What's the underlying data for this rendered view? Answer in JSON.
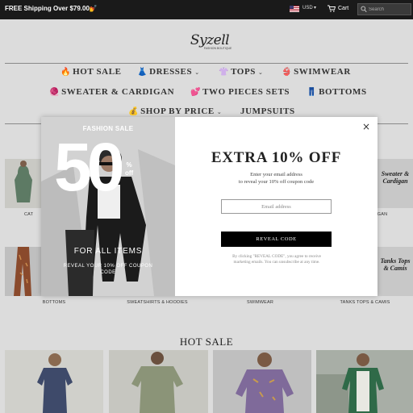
{
  "topbar": {
    "promo": "FREE Shipping Over $79.00💅",
    "currency": "USD",
    "cart_label": "Cart",
    "search_placeholder": "Search"
  },
  "logo": {
    "name": "Syzell",
    "tagline": "FASHION BOUTIQUE"
  },
  "nav": {
    "row1": [
      {
        "emoji": "🔥",
        "label": "HOT SALE",
        "has_caret": false
      },
      {
        "emoji": "👗",
        "label": "DRESSES",
        "has_caret": true
      },
      {
        "emoji": "👚",
        "label": "TOPS",
        "has_caret": true
      },
      {
        "emoji": "👙",
        "label": "SWIMWEAR",
        "has_caret": false
      }
    ],
    "row2": [
      {
        "emoji": "🧶",
        "label": "SWEATER & CARDIGAN",
        "has_caret": false
      },
      {
        "emoji": "💕",
        "label": "TWO PIECES SETS",
        "has_caret": false
      },
      {
        "emoji": "👖",
        "label": "BOTTOMS",
        "has_caret": false
      }
    ],
    "row3": [
      {
        "emoji": "💰",
        "label": "SHOP BY PRICE",
        "has_caret": true
      },
      {
        "emoji": "",
        "label": "JUMPSUITS",
        "has_caret": false
      }
    ],
    "caret": "⌄"
  },
  "categories": {
    "row1_left_label": "CAT",
    "row1_right_label": "IGAN",
    "row1_right_text": "Sweater & Cardigan",
    "row2": [
      "BOTTOMS",
      "SWEATSHIRTS & HOODIES",
      "SWIMWEAR",
      "TANKS TOPS & CAMIS"
    ],
    "row2_right_text": "Tanks Tops & Camis"
  },
  "hot_sale": {
    "title": "HOT SALE"
  },
  "modal": {
    "photo": {
      "fashion_sale": "FASHION SALE",
      "big_number": "50",
      "percent": "%",
      "off": "off",
      "for_all_items": "FOR ALL ITEMS",
      "reveal_text": "REVEAL YOUR 10% OFF COUPON CODE"
    },
    "close": "×",
    "heading": "EXTRA 10% OFF",
    "sub_line1": "Enter your email address",
    "sub_line2": "to reveal your 10% off coupon code",
    "email_placeholder": "Email address",
    "button": "REVEAL CODE",
    "disclaimer": "By clicking \"REVEAL CODE\", you agree to receive marketing emails. You can unsubscribe at any time."
  },
  "colors": {
    "topbar_bg": "#1a1a1a",
    "overlay_page": "#dcdcdc",
    "button_bg": "#000000",
    "accent_text": "#222222"
  }
}
